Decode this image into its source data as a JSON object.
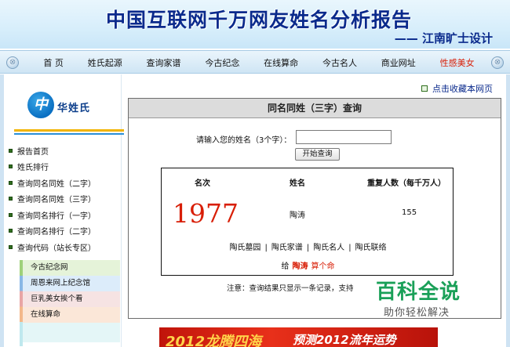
{
  "header": {
    "title": "中国互联网千万网友姓名分析报告",
    "subtitle": "—— 江南旷士设计"
  },
  "nav": {
    "items": [
      "首 页",
      "姓氏起源",
      "查询家谱",
      "今古纪念",
      "在线算命",
      "今古名人",
      "商业网址",
      "性感美女"
    ]
  },
  "sidebar": {
    "logo_mark": "中",
    "logo_text": "华姓氏",
    "menu": [
      "报告首页",
      "姓氏排行",
      "查询同名同姓（二字）",
      "查询同名同姓（三字）",
      "查询同名排行（一字）",
      "查询同名排行（二字）",
      "查询代码（站长专区）"
    ],
    "links": [
      "今古纪念网",
      "周恩来网上纪念馆",
      "巨乳美女挨个看",
      "在线算命",
      ""
    ]
  },
  "main": {
    "bookmark": "点击收藏本网页",
    "panel_title": "同名同姓（三字）查询",
    "form_label": "请输入您的姓名（3个字）：",
    "input_value": "",
    "submit_label": "开始查询",
    "table": {
      "headers": [
        "名次",
        "姓名",
        "重复人数（每千万人）"
      ],
      "rank": "1977",
      "name": "陶涛",
      "count": "155"
    },
    "related_links": [
      "陶氏墓园",
      "陶氏家谱",
      "陶氏名人",
      "陶氏联络"
    ],
    "related_sep": "|",
    "fortune_prefix": "给",
    "fortune_name": "陶涛",
    "fortune_action": "算个命",
    "note": "注意：查询结果只显示一条记录，支持"
  },
  "ad": {
    "left_text": "2012龙腾四海",
    "right_text": "预测2012流年运势"
  },
  "watermark": {
    "main": "百科全说",
    "sub": "助你轻松解决"
  },
  "colors": {
    "header_text": "#0a2a8c",
    "highlight": "#d81e06",
    "bullet": "#2f6e1e",
    "watermark": "#1aa058"
  }
}
